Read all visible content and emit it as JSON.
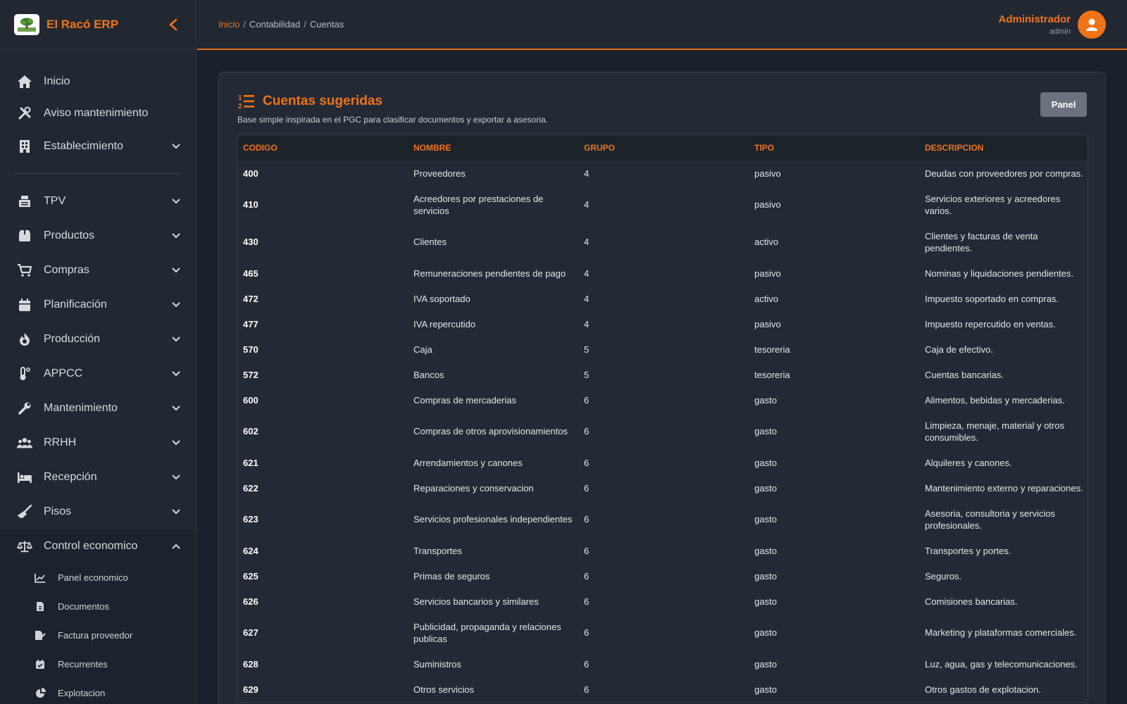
{
  "app": {
    "brand_name": "El Racó ERP"
  },
  "sidebar": {
    "items": [
      {
        "label": "Inicio",
        "icon": "home-icon"
      },
      {
        "label": "Aviso mantenimiento",
        "icon": "tools-icon"
      },
      {
        "label": "Establecimiento",
        "icon": "building-icon"
      },
      {
        "label": "TPV",
        "icon": "cash-register-icon"
      },
      {
        "label": "Productos",
        "icon": "box-icon"
      },
      {
        "label": "Compras",
        "icon": "cart-icon"
      },
      {
        "label": "Planificación",
        "icon": "calendar-icon"
      },
      {
        "label": "Producción",
        "icon": "fire-icon"
      },
      {
        "label": "APPCC",
        "icon": "thermometer-icon"
      },
      {
        "label": "Mantenimiento",
        "icon": "wrench-icon"
      },
      {
        "label": "RRHH",
        "icon": "users-icon"
      },
      {
        "label": "Recepción",
        "icon": "bed-icon"
      },
      {
        "label": "Pisos",
        "icon": "broom-icon"
      },
      {
        "label": "Control economico",
        "icon": "scale-icon"
      }
    ],
    "sub_items": [
      {
        "label": "Panel economico",
        "icon": "chart-line-icon"
      },
      {
        "label": "Documentos",
        "icon": "file-icon"
      },
      {
        "label": "Factura proveedor",
        "icon": "file-edit-icon"
      },
      {
        "label": "Recurrentes",
        "icon": "calendar-check-icon"
      },
      {
        "label": "Explotacion",
        "icon": "pie-chart-icon"
      }
    ]
  },
  "header": {
    "breadcrumb": [
      "Inicio",
      "Contabilidad",
      "Cuentas"
    ],
    "separator": "/",
    "user_name": "Administrador",
    "user_role": "admin"
  },
  "main": {
    "title": "Cuentas sugeridas",
    "subtitle": "Base simple inspirada en el PGC para clasificar documentos y exportar a asesoria.",
    "panel_button": "Panel",
    "columns": [
      "CODIGO",
      "NOMBRE",
      "GRUPO",
      "TIPO",
      "DESCRIPCION"
    ],
    "rows": [
      [
        "400",
        "Proveedores",
        "4",
        "pasivo",
        "Deudas con proveedores por compras."
      ],
      [
        "410",
        "Acreedores por prestaciones de servicios",
        "4",
        "pasivo",
        "Servicios exteriores y acreedores varios."
      ],
      [
        "430",
        "Clientes",
        "4",
        "activo",
        "Clientes y facturas de venta pendientes."
      ],
      [
        "465",
        "Remuneraciones pendientes de pago",
        "4",
        "pasivo",
        "Nominas y liquidaciones pendientes."
      ],
      [
        "472",
        "IVA soportado",
        "4",
        "activo",
        "Impuesto soportado en compras."
      ],
      [
        "477",
        "IVA repercutido",
        "4",
        "pasivo",
        "Impuesto repercutido en ventas."
      ],
      [
        "570",
        "Caja",
        "5",
        "tesoreria",
        "Caja de efectivo."
      ],
      [
        "572",
        "Bancos",
        "5",
        "tesoreria",
        "Cuentas bancarias."
      ],
      [
        "600",
        "Compras de mercaderias",
        "6",
        "gasto",
        "Alimentos, bebidas y mercaderias."
      ],
      [
        "602",
        "Compras de otros aprovisionamientos",
        "6",
        "gasto",
        "Limpieza, menaje, material y otros consumibles."
      ],
      [
        "621",
        "Arrendamientos y canones",
        "6",
        "gasto",
        "Alquileres y canones."
      ],
      [
        "622",
        "Reparaciones y conservacion",
        "6",
        "gasto",
        "Mantenimiento externo y reparaciones."
      ],
      [
        "623",
        "Servicios profesionales independientes",
        "6",
        "gasto",
        "Asesoria, consultoria y servicios profesionales."
      ],
      [
        "624",
        "Transportes",
        "6",
        "gasto",
        "Transportes y portes."
      ],
      [
        "625",
        "Primas de seguros",
        "6",
        "gasto",
        "Seguros."
      ],
      [
        "626",
        "Servicios bancarios y similares",
        "6",
        "gasto",
        "Comisiones bancarias."
      ],
      [
        "627",
        "Publicidad, propaganda y relaciones publicas",
        "6",
        "gasto",
        "Marketing y plataformas comerciales."
      ],
      [
        "628",
        "Suministros",
        "6",
        "gasto",
        "Luz, agua, gas y telecomunicaciones."
      ],
      [
        "629",
        "Otros servicios",
        "6",
        "gasto",
        "Otros gastos de explotacion."
      ]
    ]
  },
  "colors": {
    "accent": "#f07318",
    "sidebar_bg": "#212832",
    "page_bg": "#1b212c",
    "card_bg": "#232a35"
  }
}
